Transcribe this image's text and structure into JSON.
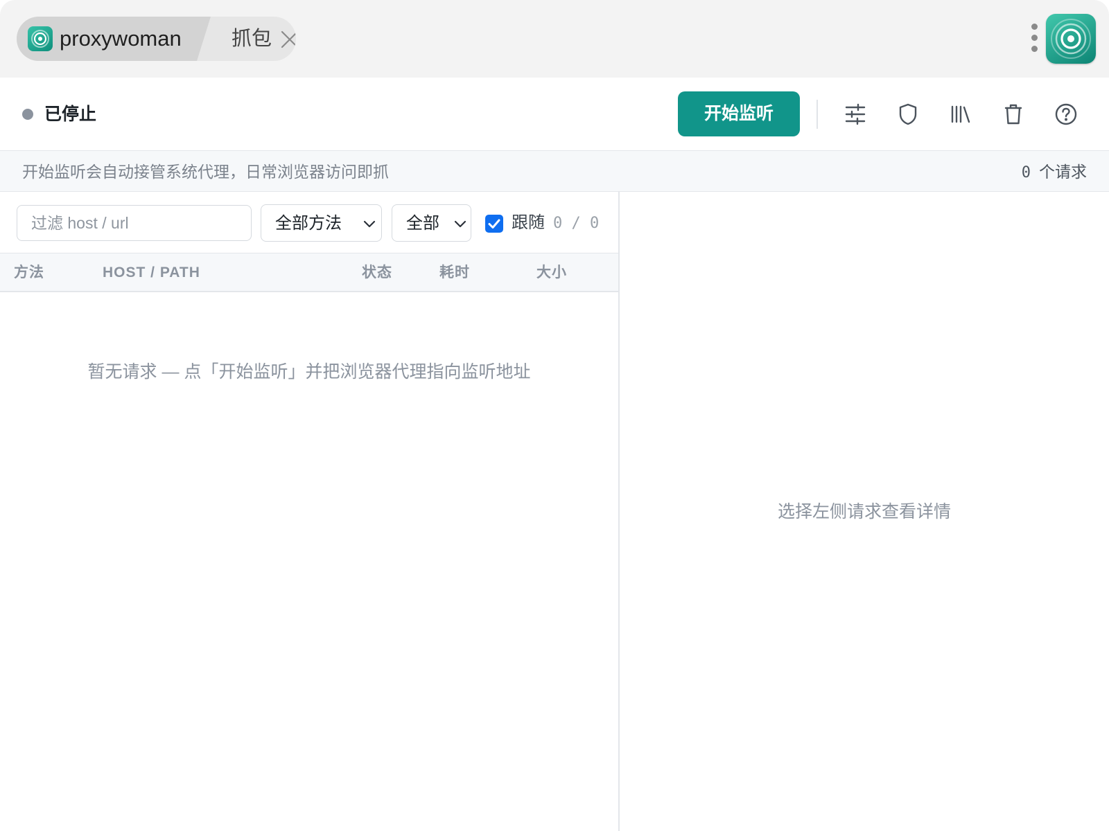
{
  "titlebar": {
    "tabs": [
      {
        "label": "proxywoman",
        "active": true
      },
      {
        "label": "抓包",
        "active": false
      }
    ]
  },
  "toolbar": {
    "status_text": "已停止",
    "start_label": "开始监听",
    "icons": [
      "sliders-icon",
      "shield-icon",
      "library-icon",
      "trash-icon",
      "help-icon"
    ]
  },
  "infobar": {
    "hint": "开始监听会自动接管系统代理，日常浏览器访问即抓",
    "count": "0",
    "count_suffix": "个请求"
  },
  "filters": {
    "search_placeholder": "过滤 host / url",
    "method_selected": "全部方法",
    "type_selected": "全部",
    "follow_label": "跟随",
    "follow_checked": true,
    "follow_count": "0 / 0"
  },
  "table": {
    "columns": [
      "方法",
      "HOST / PATH",
      "状态",
      "耗时",
      "大小"
    ],
    "rows": [],
    "empty_text": "暂无请求 — 点「开始监听」并把浏览器代理指向监听地址"
  },
  "detail": {
    "empty_text": "选择左侧请求查看详情"
  },
  "colors": {
    "accent": "#11958a",
    "checkbox": "#0f6ef0",
    "status_idle": "#8b939e"
  }
}
